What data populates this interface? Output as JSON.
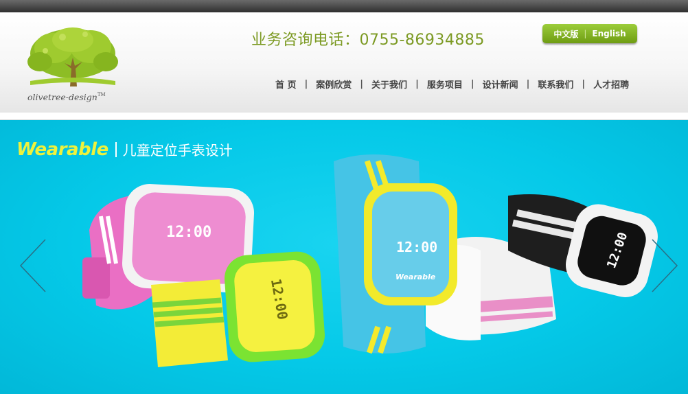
{
  "header": {
    "logo_text": "olivetree-design",
    "logo_tm": "TM",
    "hotline": "业务咨询电话：0755-86934885"
  },
  "language": {
    "chinese": "中文版",
    "separator": "|",
    "english": "English"
  },
  "nav": {
    "items": [
      {
        "label": "首 页"
      },
      {
        "label": "案例欣赏"
      },
      {
        "label": "关于我们"
      },
      {
        "label": "服务项目"
      },
      {
        "label": "设计新闻"
      },
      {
        "label": "联系我们"
      },
      {
        "label": "人才招聘"
      }
    ],
    "separator": "|"
  },
  "banner": {
    "brand": "Wearable",
    "subtitle": "儿童定位手表设计",
    "watch_time": "12:00",
    "watch_brand": "Wearable",
    "prev_icon": "chevron-left-icon",
    "next_icon": "chevron-right-icon"
  },
  "colors": {
    "accent_green": "#7c9a23",
    "banner_cyan": "#05c9e8",
    "topbar": "#3a3a3a"
  }
}
